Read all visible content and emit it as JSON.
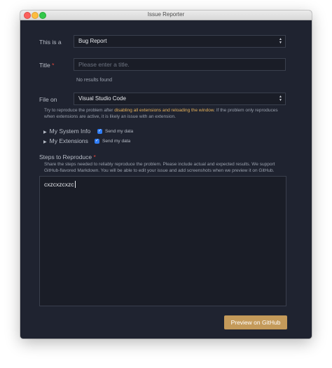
{
  "window": {
    "title": "Issue Reporter"
  },
  "form": {
    "issue_type": {
      "label": "This is a",
      "value": "Bug Report"
    },
    "title_field": {
      "label": "Title",
      "required_mark": "*",
      "placeholder": "Please enter a title.",
      "hint": "No results found"
    },
    "file_on": {
      "label": "File on",
      "value": "Visual Studio Code"
    },
    "reproduce_note": {
      "before": "Try to reproduce the problem after ",
      "link": "disabling all extensions and reloading the window",
      "after": ". If the problem only reproduces when extensions are active, it is likely an issue with an extension."
    },
    "system_info": {
      "label": "My System Info",
      "send_label": "Send my data",
      "checked": true
    },
    "extensions": {
      "label": "My Extensions",
      "send_label": "Send my data",
      "checked": true
    },
    "steps": {
      "label": "Steps to Reproduce",
      "required_mark": "*",
      "description": "Share the steps needed to reliably reproduce the problem. Please include actual and expected results. We support GitHub-flavored Markdown. You will be able to edit your issue and add screenshots when we preview it on GitHub.",
      "value": "cxzcxzcxzc"
    },
    "preview_button": "Preview on GitHub"
  },
  "colors": {
    "background": "#1f2330",
    "accent_button": "#c49a5a",
    "link_highlight": "#e8b35b",
    "required": "#e0463c",
    "checkbox": "#2f7df6"
  }
}
